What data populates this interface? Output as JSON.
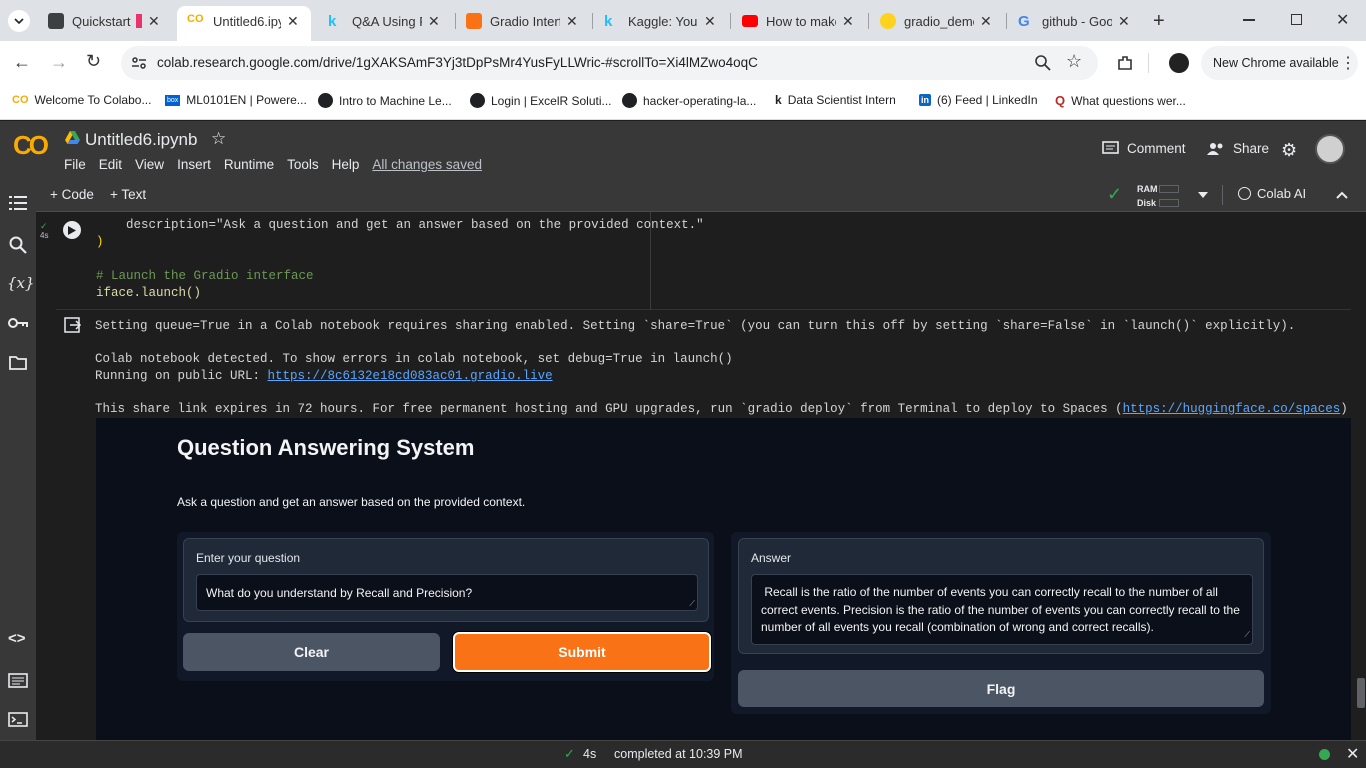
{
  "browser": {
    "tabs": [
      {
        "title": "Quickstart |",
        "color": "#3c4043"
      },
      {
        "title": "Untitled6.ipy",
        "color": "#f9ab00"
      },
      {
        "title": "Q&A Using F",
        "color": "#20beff"
      },
      {
        "title": "Gradio Interf",
        "color": "#f97316"
      },
      {
        "title": "Kaggle: Your",
        "color": "#20beff"
      },
      {
        "title": "How to make",
        "color": "#ff0000"
      },
      {
        "title": "gradio_demo",
        "color": "#ffd21e"
      },
      {
        "title": "github - Goo",
        "color": "#4285f4"
      }
    ],
    "url": "colab.research.google.com/drive/1gXAKSAmF3Yj3tDpPsMr4YusFyLLWric-#scrollTo=Xi4lMZwo4oqC",
    "update_label": "New Chrome available",
    "bookmarks": [
      {
        "label": "Welcome To Colabo...",
        "color": "#f9ab00"
      },
      {
        "label": "ML0101EN | Powere...",
        "color": "#0061d5"
      },
      {
        "label": "Intro to Machine Le...",
        "color": "#202124"
      },
      {
        "label": "Login | ExcelR Soluti...",
        "color": "#202124"
      },
      {
        "label": "hacker-operating-la...",
        "color": "#202124"
      },
      {
        "label": "Data Scientist Intern",
        "color": "#202124"
      },
      {
        "label": "(6) Feed | LinkedIn",
        "color": "#0a66c2"
      },
      {
        "label": "What questions wer...",
        "color": "#b92b27"
      }
    ]
  },
  "colab": {
    "logo": "CO",
    "notebook_title": "Untitled6.ipynb",
    "menu": [
      "File",
      "Edit",
      "View",
      "Insert",
      "Runtime",
      "Tools",
      "Help"
    ],
    "saved_status": "All changes saved",
    "comment_label": "Comment",
    "share_label": "Share",
    "add_code": "+ Code",
    "add_text": "+ Text",
    "ram_label": "RAM",
    "disk_label": "Disk",
    "colab_ai": "Colab AI",
    "exec_time": "4s"
  },
  "cell": {
    "code_lines": [
      "    description=\"Ask a question and get an answer based on the provided context.\"",
      ")",
      "",
      "# Launch the Gradio interface",
      "iface.launch()"
    ],
    "output": {
      "line1": "Setting queue=True in a Colab notebook requires sharing enabled. Setting `share=True` (you can turn this off by setting `share=False` in `launch()` explicitly).",
      "line2": "Colab notebook detected. To show errors in colab notebook, set debug=True in launch()",
      "line3_prefix": "Running on public URL: ",
      "public_url": "https://8c6132e18cd083ac01.gradio.live",
      "line4_prefix": "This share link expires in 72 hours. For free permanent hosting and GPU upgrades, run `gradio deploy` from Terminal to deploy to Spaces (",
      "spaces_url": "https://huggingface.co/spaces",
      "line4_suffix": ")"
    }
  },
  "gradio": {
    "title": "Question Answering System",
    "description": "Ask a question and get an answer based on the provided context.",
    "question_label": "Enter your question",
    "question_value": "What do you understand by Recall and Precision?",
    "answer_label": "Answer",
    "answer_value": " Recall is the ratio of the number of events you can correctly recall to the number of all correct events. Precision is the ratio of the number of events you can correctly recall to the number of all events you recall (combination of wrong and correct recalls).",
    "clear_label": "Clear",
    "submit_label": "Submit",
    "flag_label": "Flag",
    "accent_color": "#f97316"
  },
  "status": {
    "check": "4s",
    "text": "completed at 10:39 PM"
  }
}
